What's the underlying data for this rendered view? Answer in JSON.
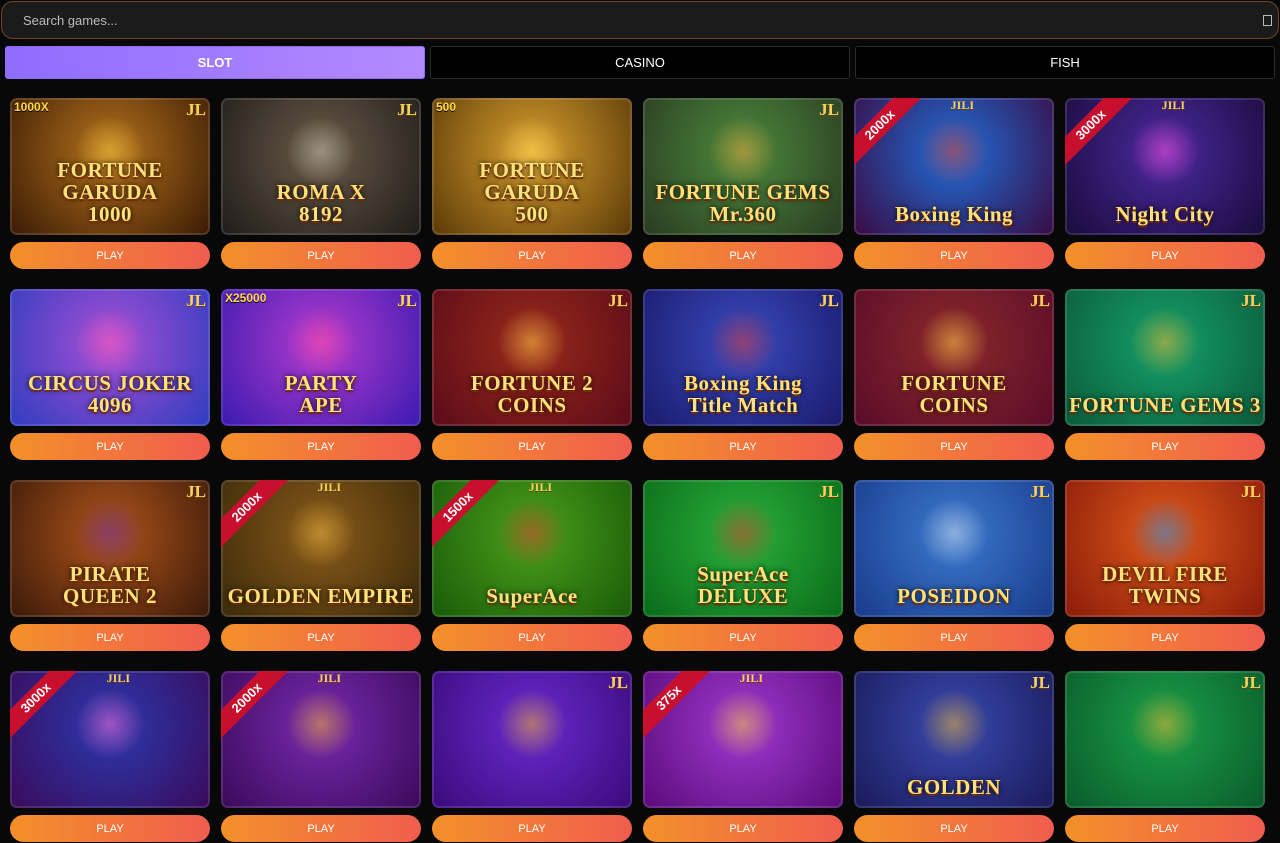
{
  "search": {
    "placeholder": "Search games..."
  },
  "tabs": [
    {
      "label": "SLOT",
      "active": true
    },
    {
      "label": "CASINO",
      "active": false
    },
    {
      "label": "FISH",
      "active": false
    }
  ],
  "games": [
    {
      "name": "FORTUNE GARUDA\n1000",
      "logo": "JL",
      "badge": "1000X",
      "bg": [
        "#3a1a05",
        "#b5731c"
      ],
      "art": "#f2c440"
    },
    {
      "name": "ROMA X\n8192",
      "logo": "JL",
      "badge": "",
      "bg": [
        "#1f1c1a",
        "#6a5a48"
      ],
      "art": "#c2bcb0"
    },
    {
      "name": "FORTUNE GARUDA\n500",
      "logo": "",
      "badge": "500",
      "bg": [
        "#5a3908",
        "#d9a02e"
      ],
      "art": "#ffd75a"
    },
    {
      "name": "FORTUNE GEMS\nMr.360",
      "logo": "JL",
      "badge": "",
      "bg": [
        "#2a3a22",
        "#4c8a3c"
      ],
      "art": "#e6a240"
    },
    {
      "name": "Boxing King",
      "logo": "JILI",
      "ribbon": "2000x",
      "bg": [
        "#3a0a42",
        "#1e6fd9"
      ],
      "art": "#e23a2a"
    },
    {
      "name": "Night City",
      "logo": "JILI",
      "ribbon": "3000x",
      "bg": [
        "#1a0b3a",
        "#4a2aa0"
      ],
      "art": "#ff4ee0"
    },
    {
      "name": "CIRCUS JOKER\n4096",
      "logo": "JL",
      "badge": "",
      "bg": [
        "#2e3dbf",
        "#a84fd6"
      ],
      "art": "#ff5ab8"
    },
    {
      "name": "PARTY\nAPE",
      "logo": "JL",
      "badge": "X25000",
      "bg": [
        "#3a1ab0",
        "#b43ccf"
      ],
      "art": "#ff4aa0"
    },
    {
      "name": "FORTUNE 2\nCOINS",
      "logo": "JL",
      "badge": "",
      "bg": [
        "#5a0b1a",
        "#9a2a1a"
      ],
      "art": "#ffc84a"
    },
    {
      "name": "Boxing King\nTitle Match",
      "logo": "JL",
      "badge": "",
      "bg": [
        "#1a1a6a",
        "#3a4ac0"
      ],
      "art": "#d23a3a"
    },
    {
      "name": "FORTUNE\nCOINS",
      "logo": "JL",
      "badge": "",
      "bg": [
        "#5a0b2a",
        "#8a2a2a"
      ],
      "art": "#ffc84a"
    },
    {
      "name": "FORTUNE GEMS 3",
      "logo": "JL",
      "badge": "",
      "bg": [
        "#0b5a3a",
        "#15a06a"
      ],
      "art": "#e8b030"
    },
    {
      "name": "PIRATE\nQUEEN 2",
      "logo": "JL",
      "badge": "",
      "bg": [
        "#3a1a0a",
        "#b0541a"
      ],
      "art": "#6a2aa0"
    },
    {
      "name": "GOLDEN EMPIRE",
      "logo": "JILI",
      "ribbon": "2000x",
      "bg": [
        "#3a2a0a",
        "#8a5a1a"
      ],
      "art": "#e6b440"
    },
    {
      "name": "SuperAce",
      "logo": "JILI",
      "ribbon": "1500x",
      "bg": [
        "#1a5a0a",
        "#4aa01a"
      ],
      "art": "#d23a2a"
    },
    {
      "name": "SuperAce\nDELUXE",
      "logo": "JL",
      "badge": "",
      "bg": [
        "#0a6a1a",
        "#2ab03a"
      ],
      "art": "#d23a2a"
    },
    {
      "name": "POSEIDON",
      "logo": "JL",
      "badge": "",
      "bg": [
        "#1a3a8a",
        "#3a7ad0"
      ],
      "art": "#cfd8e6"
    },
    {
      "name": "DEVIL FIRE\nTWINS",
      "logo": "JL",
      "badge": "",
      "bg": [
        "#8a1a0a",
        "#e05a1a"
      ],
      "art": "#2a8ae0"
    },
    {
      "name": "",
      "logo": "JILI",
      "ribbon": "3000x",
      "bg": [
        "#3a0a5a",
        "#2a3ab0"
      ],
      "art": "#ff6ad0"
    },
    {
      "name": "",
      "logo": "JILI",
      "ribbon": "2000x",
      "bg": [
        "#3a0a5a",
        "#7a2ab0"
      ],
      "art": "#e8b030"
    },
    {
      "name": "",
      "logo": "JL",
      "badge": "",
      "bg": [
        "#3a0a7a",
        "#6a2ad0"
      ],
      "art": "#e8b030"
    },
    {
      "name": "",
      "logo": "JILI",
      "ribbon": "375x",
      "bg": [
        "#5a0a7a",
        "#a03ad0"
      ],
      "art": "#f2c440"
    },
    {
      "name": "GOLDEN",
      "logo": "JL",
      "badge": "",
      "bg": [
        "#1a1a5a",
        "#3a4ab0"
      ],
      "art": "#e8b030"
    },
    {
      "name": "",
      "logo": "JL",
      "badge": "",
      "bg": [
        "#0a5a2a",
        "#1aa04a"
      ],
      "art": "#e8b030"
    }
  ],
  "play_label": "PLAY"
}
